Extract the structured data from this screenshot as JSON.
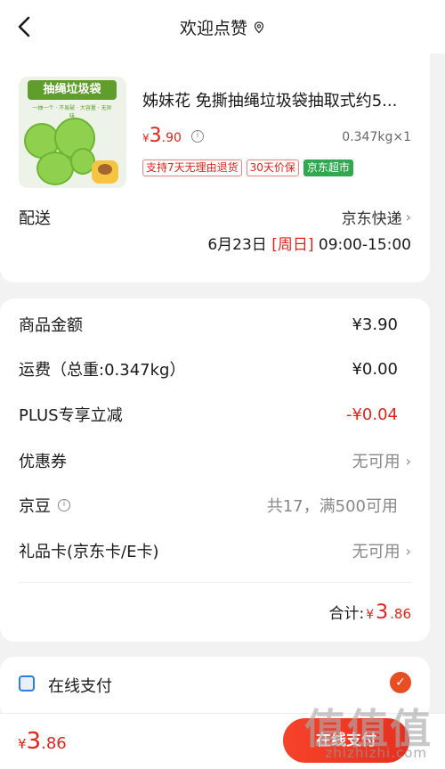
{
  "header": {
    "title": "欢迎点赞"
  },
  "product": {
    "thumb_banner": "抽绳垃圾袋",
    "thumb_sub": "一抽一个 · 不易破 · 大容量 · 无异味",
    "name": "姊妹花 免撕抽绳垃圾袋抽取式约5...",
    "price": {
      "currency": "¥",
      "int": "3",
      "dec": ".90"
    },
    "weight_qty": "0.347kg×1",
    "tags": [
      "支持7天无理由退货",
      "30天价保",
      "京东超市"
    ]
  },
  "shipping": {
    "label": "配送",
    "carrier": "京东快递",
    "date": "6月23日",
    "weekday": "[周日]",
    "time": "09:00-15:00"
  },
  "summary": {
    "rows": [
      {
        "label": "商品金额",
        "value": "¥3.90",
        "style": "normal"
      },
      {
        "label": "运费（总重:0.347kg）",
        "value": "¥0.00",
        "style": "normal"
      },
      {
        "label": "PLUS专享立减",
        "value": "-¥0.04",
        "style": "red"
      },
      {
        "label": "优惠券",
        "value": "无可用",
        "style": "gray",
        "chevron": true
      },
      {
        "label": "京豆",
        "value": "共17，满500可用",
        "style": "gray",
        "info": true
      },
      {
        "label": "礼品卡(京东卡/E卡)",
        "value": "无可用",
        "style": "gray",
        "chevron": true
      }
    ],
    "total_label": "合计:",
    "total": {
      "currency": "¥",
      "int": "3",
      "dec": ".86"
    }
  },
  "payment": {
    "label": "在线支付"
  },
  "bottom_bar": {
    "price": {
      "currency": "¥",
      "int": "3",
      "dec": ".86"
    },
    "button": "在线支付"
  },
  "watermark": {
    "chars": "值值值",
    "url": "zhizhizhi.com"
  },
  "colors": {
    "accent": "#e2231a",
    "button": "#f6432a",
    "jd_green": "#2fa84f"
  }
}
